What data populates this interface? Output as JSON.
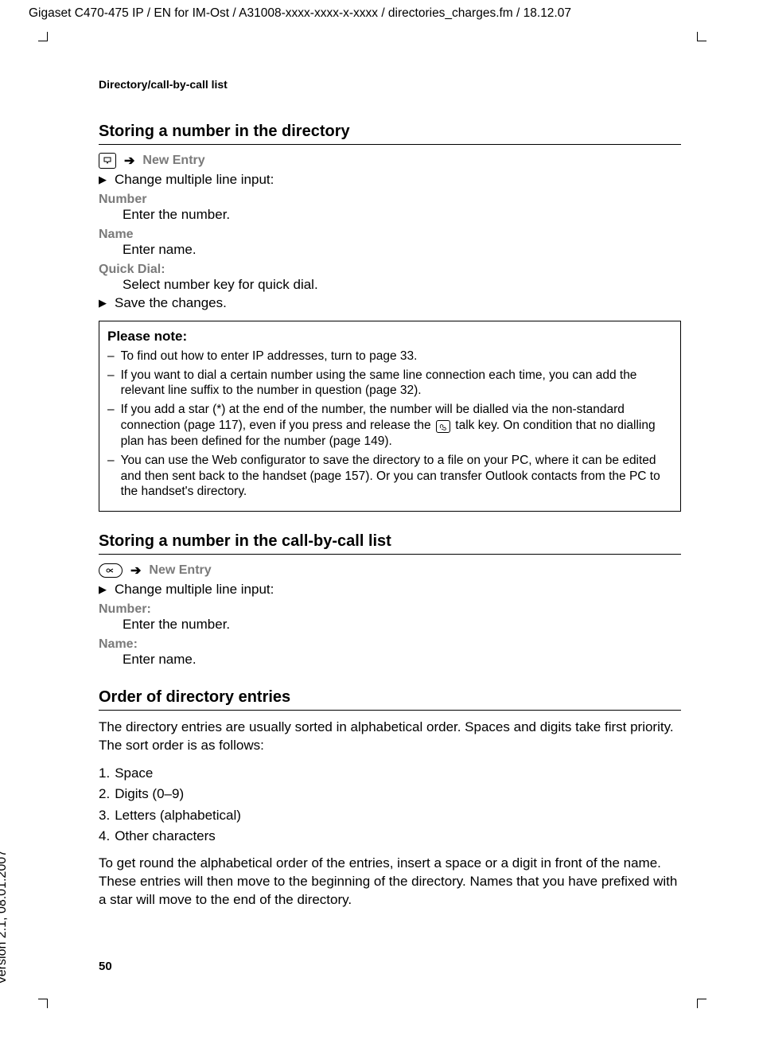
{
  "meta": {
    "path": "Gigaset C470-475 IP / EN for IM-Ost / A31008-xxxx-xxxx-x-xxxx / directories_charges.fm / 18.12.07",
    "version": "Version 2.1, 08.01.2007",
    "running_head": "Directory/call-by-call list",
    "page_number": "50"
  },
  "sec1": {
    "title": "Storing a number in the directory",
    "nav_new_entry": "New Entry",
    "step_change": "Change multiple line input:",
    "fields": {
      "number_label": "Number",
      "number_desc": "Enter the number.",
      "name_label": "Name",
      "name_desc": "Enter name.",
      "quick_label": "Quick Dial:",
      "quick_desc": "Select number key for quick dial."
    },
    "step_save": "Save the changes."
  },
  "note": {
    "title": "Please note:",
    "items": [
      "To find out how to enter IP addresses, turn to page 33.",
      "If you want to dial a certain number using the same line connection each time, you can add the relevant line suffix to the number in question (page 32).",
      "If you add a star (*) at the end of the number, the number will be dialled via the non-standard connection (page 117), even if you press and release the __TALK__ talk key. On condition that no dialling plan has been defined for the number (page 149).",
      "You can use the Web configurator to save the directory to a file on your PC, where it can be edited and then sent back to the handset (page 157). Or you can transfer Outlook contacts from the PC to the handset's directory."
    ]
  },
  "sec2": {
    "title": "Storing a number in the call-by-call list",
    "nav_new_entry": "New Entry",
    "step_change": "Change multiple line input:",
    "fields": {
      "number_label": "Number:",
      "number_desc": "Enter the number.",
      "name_label": "Name:",
      "name_desc": "Enter name."
    }
  },
  "sec3": {
    "title": "Order of directory entries",
    "intro": "The directory entries are usually sorted in alphabetical order. Spaces and digits take first priority. The sort order is as follows:",
    "list": [
      "Space",
      "Digits (0–9)",
      "Letters (alphabetical)",
      "Other characters"
    ],
    "outro": "To get round the alphabetical order of the entries, insert a space or a digit in front of the name. These entries will then move to the beginning of the directory. Names that you have prefixed with a star will move to the end of the directory."
  }
}
